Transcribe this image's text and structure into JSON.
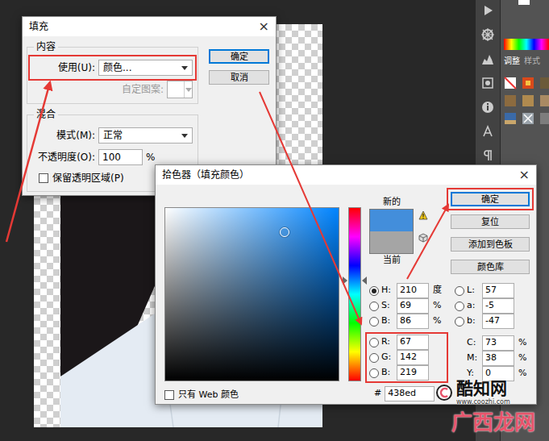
{
  "workspace": {
    "panel_tabs": [
      {
        "label": "调整",
        "selected": true
      },
      {
        "label": "样式",
        "selected": false
      }
    ]
  },
  "fill_dialog": {
    "title": "填充",
    "close": "×",
    "content_group": "内容",
    "use": {
      "label": "使用(U):",
      "value": "颜色...",
      "highlighted": true
    },
    "pattern": {
      "label": "自定图案:",
      "disabled": true
    },
    "blend_group": "混合",
    "mode": {
      "label": "模式(M):",
      "value": "正常"
    },
    "opacity": {
      "label": "不透明度(O):",
      "value": "100",
      "unit": "%"
    },
    "preserve": {
      "label": "保留透明区域(P)",
      "checked": false
    },
    "buttons": [
      {
        "label": "确定",
        "selected": true
      },
      {
        "label": "取消",
        "selected": false
      }
    ]
  },
  "color_picker": {
    "title": "拾色器（填充颜色）",
    "close": "×",
    "new_label": "新的",
    "current_label": "当前",
    "new_color": "#438edb",
    "current_color": "#a5a5a5",
    "hue_level": 0.58,
    "saturation_level": 0.69,
    "brightness_level": 0.86,
    "buttons": [
      {
        "label": "确定",
        "selected": true,
        "highlighted": true
      },
      {
        "label": "复位",
        "selected": false,
        "highlighted": false
      },
      {
        "label": "添加到色板",
        "selected": false,
        "highlighted": false
      },
      {
        "label": "颜色库",
        "selected": false,
        "highlighted": false
      }
    ],
    "hsb_fields": [
      {
        "label": "H:",
        "value": "210",
        "unit": "度",
        "selected": true
      },
      {
        "label": "S:",
        "value": "69",
        "unit": "%",
        "selected": false
      },
      {
        "label": "B:",
        "value": "86",
        "unit": "%",
        "selected": false
      }
    ],
    "rgb_highlighted": true,
    "rgb_fields": [
      {
        "label": "R:",
        "value": "67",
        "selected": false
      },
      {
        "label": "G:",
        "value": "142",
        "selected": false
      },
      {
        "label": "B:",
        "value": "219",
        "selected": false
      }
    ],
    "lab_fields": [
      {
        "label": "L:",
        "value": "57",
        "selected": false
      },
      {
        "label": "a:",
        "value": "-5",
        "selected": false
      },
      {
        "label": "b:",
        "value": "-47",
        "selected": false
      }
    ],
    "cmyk_fields": [
      {
        "label": "C:",
        "value": "73",
        "unit": "%"
      },
      {
        "label": "M:",
        "value": "38",
        "unit": "%"
      },
      {
        "label": "Y:",
        "value": "0",
        "unit": "%"
      }
    ],
    "web_only": {
      "label": "只有 Web 颜色",
      "checked": false
    },
    "hex_label": "#",
    "hex_value": "438ed"
  },
  "watermark": {
    "site": "酷知网",
    "url": "www.coozhi.com",
    "corner": "广西龙网"
  }
}
